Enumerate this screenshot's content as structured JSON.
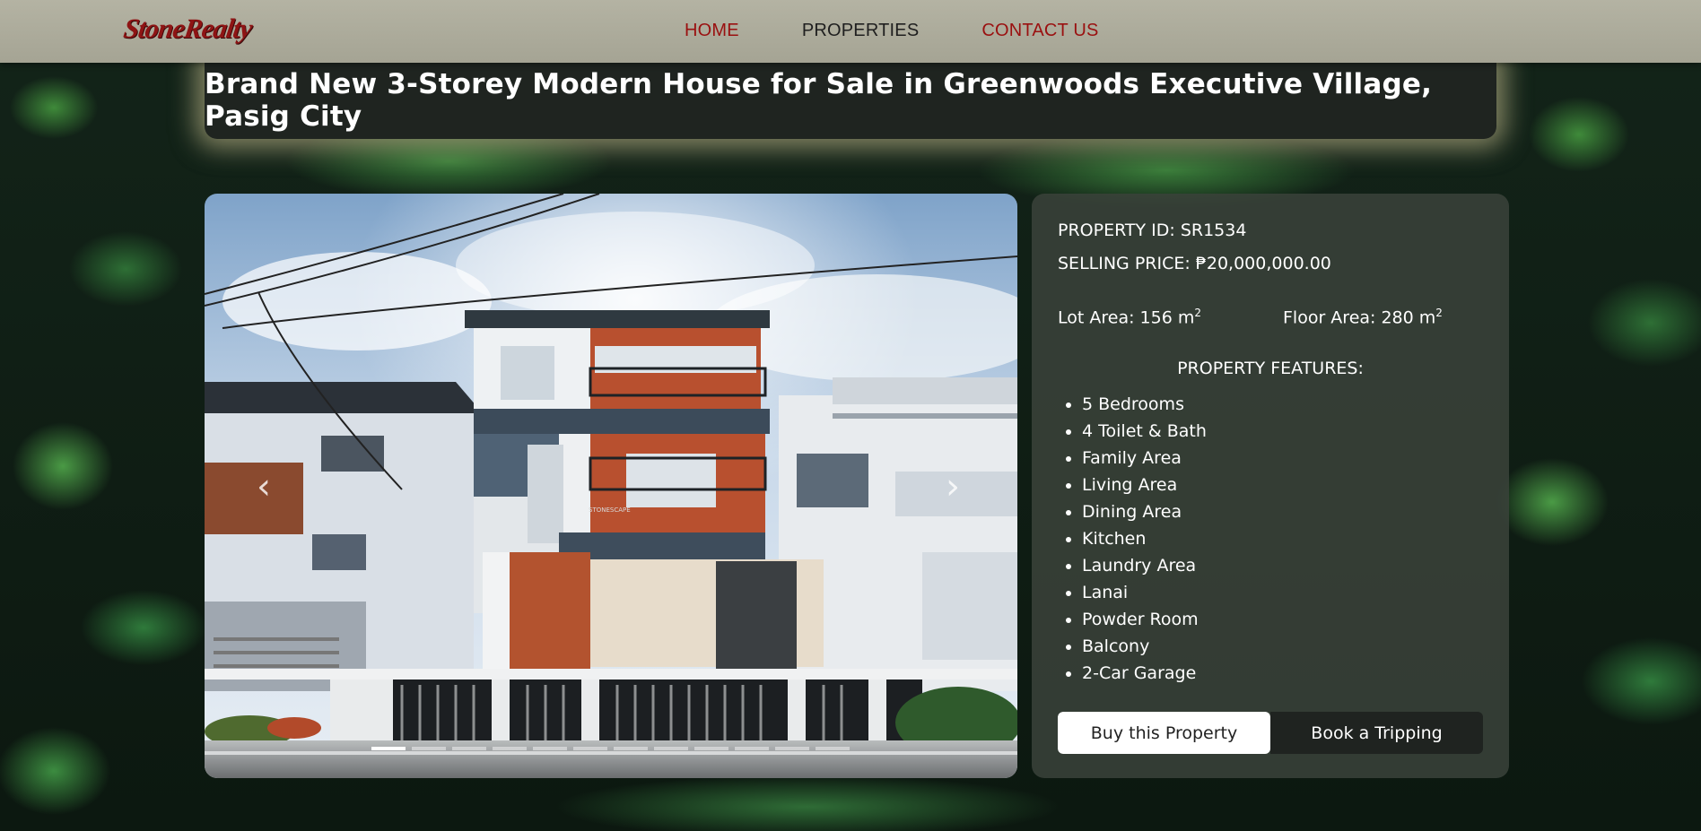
{
  "nav": {
    "logo": "StoneRealty",
    "links": [
      {
        "label": "HOME",
        "color": "#9a1010"
      },
      {
        "label": "PROPERTIES",
        "color": "#1f1f1f"
      },
      {
        "label": "CONTACT US",
        "color": "#9a1010"
      }
    ]
  },
  "listing": {
    "title": "Brand New 3-Storey Modern House for Sale in Greenwoods Executive Village, Pasig City"
  },
  "carousel": {
    "prev_icon": "chevron-left-icon",
    "next_icon": "chevron-right-icon",
    "slide_count": 12,
    "active_slide": 1,
    "watermark": "STONESCAPE"
  },
  "details": {
    "property_id": "PROPERTY ID: SR1534",
    "selling_price": "SELLING PRICE: ₱20,000,000.00",
    "lot_area_label": "Lot Area: 156 m",
    "floor_area_label": "Floor Area: 280 m",
    "area_superscript": "2",
    "features_title": "PROPERTY FEATURES:",
    "features": [
      "5 Bedrooms",
      "4 Toilet & Bath",
      "Family Area",
      "Living Area",
      "Dining Area",
      "Kitchen",
      "Laundry Area",
      "Lanai",
      "Powder Room",
      "Balcony",
      "2-Car Garage"
    ]
  },
  "actions": {
    "buy_label": "Buy this Property",
    "book_label": "Book a Tripping"
  },
  "colors": {
    "brand_red": "#8e1414",
    "panel_dark": "#1f2420",
    "glow": "#e2d6a0"
  }
}
